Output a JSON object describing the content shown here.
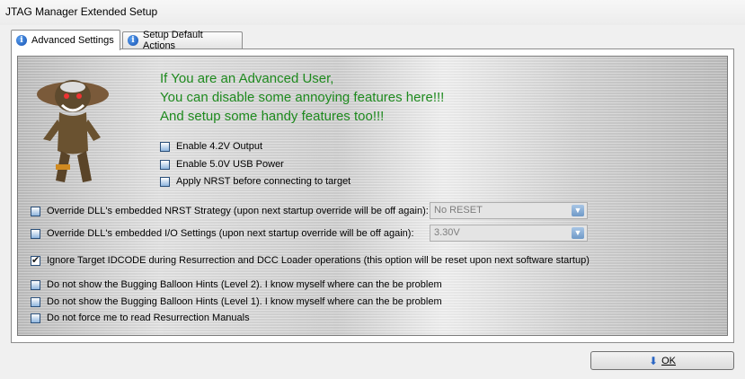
{
  "window": {
    "title": "JTAG Manager Extended Setup"
  },
  "tabs": [
    {
      "label": "Advanced Settings",
      "icon": "info-icon",
      "active": true
    },
    {
      "label": "Setup Default Actions",
      "icon": "info-icon",
      "active": false
    }
  ],
  "headline": [
    "If You are an Advanced User,",
    "You can disable some annoying features here!!!",
    "And setup some handy features too!!!"
  ],
  "options": {
    "enable_42v": {
      "label": "Enable 4.2V Output",
      "checked": false
    },
    "enable_50v": {
      "label": "Enable 5.0V USB Power",
      "checked": false
    },
    "apply_nrst": {
      "label": "Apply NRST before connecting to target",
      "checked": false
    },
    "override_nrst": {
      "label": "Override DLL's embedded NRST Strategy (upon next startup override will be off again):",
      "checked": false
    },
    "override_io": {
      "label": "Override DLL's embedded I/O Settings (upon next startup override will be off again):",
      "checked": false
    },
    "ignore_idcode": {
      "label": "Ignore Target IDCODE during Resurrection and DCC Loader operations (this option will be reset upon next software startup)",
      "checked": true
    },
    "no_hints_l2": {
      "label": "Do not show the Bugging Balloon Hints (Level 2). I know myself where can the be problem",
      "checked": false
    },
    "no_hints_l1": {
      "label": "Do not show the Bugging Balloon Hints (Level 1). I know myself where can the be problem",
      "checked": false
    },
    "no_manuals": {
      "label": "Do not force me to read Resurrection Manuals",
      "checked": false
    }
  },
  "dropdowns": {
    "nrst_strategy": {
      "value": "No RESET"
    },
    "io_settings": {
      "value": "3.30V"
    }
  },
  "buttons": {
    "ok": "OK"
  },
  "colors": {
    "headline": "#1e8a1e",
    "accent": "#2a66c4"
  }
}
